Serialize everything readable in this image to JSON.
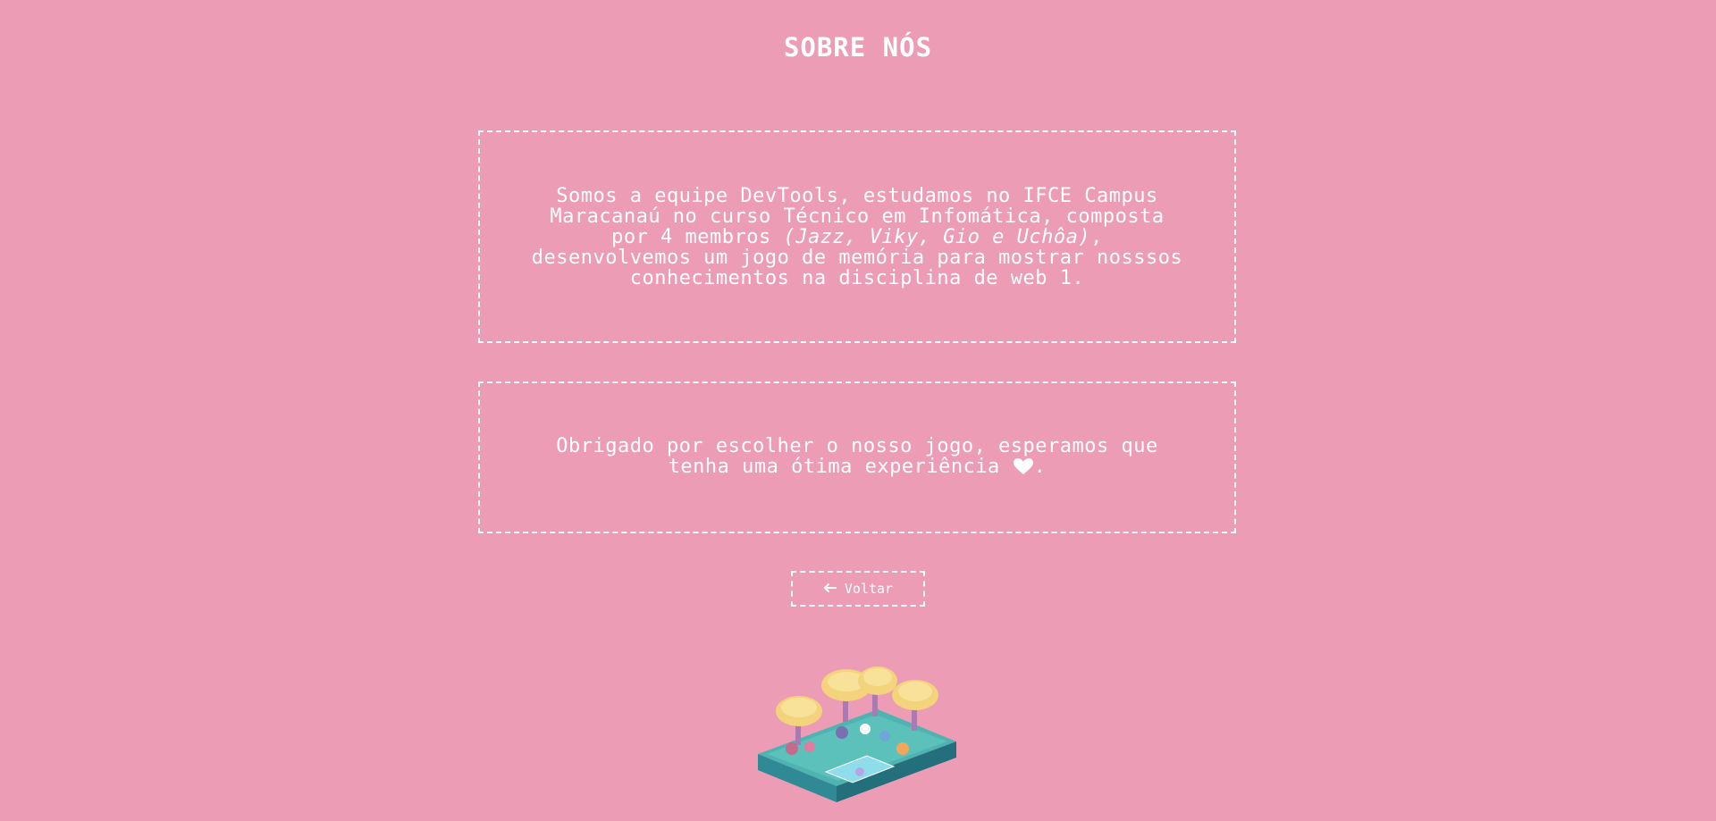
{
  "page": {
    "title": "SOBRE NÓS"
  },
  "about": {
    "text_before": "Somos a equipe DevTools, estudamos no IFCE Campus Maracanaú no curso Técnico em Infomática, composta por 4 membros ",
    "members": "(Jazz, Viky, Gio e Uchôa)",
    "text_after": ", desenvolvemos um jogo de memória para mostrar nosssos conhecimentos na disciplina de web 1."
  },
  "thanks": {
    "text": "Obrigado por escolher o nosso jogo, esperamos que tenha uma ótima experiência ",
    "end": ".",
    "icon": "heart-icon"
  },
  "back_button": {
    "label": "Voltar",
    "icon": "arrow-left-icon"
  },
  "illustration": {
    "icon": "isometric-park-illustration"
  },
  "colors": {
    "background": "#ec9cb4",
    "foreground": "#ffffff"
  }
}
